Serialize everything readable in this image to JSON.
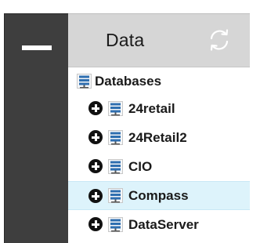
{
  "panel": {
    "title": "Data",
    "refresh_icon": "refresh-icon",
    "collapse_icon": "minus-icon"
  },
  "tree": {
    "root": {
      "label": "Databases",
      "icon": "database-icon"
    },
    "items": [
      {
        "label": "24retail",
        "icon": "database-icon",
        "expander": "plus-circle-icon",
        "selected": false
      },
      {
        "label": "24Retail2",
        "icon": "database-icon",
        "expander": "plus-circle-icon",
        "selected": false
      },
      {
        "label": "CIO",
        "icon": "database-icon",
        "expander": "plus-circle-icon",
        "selected": false
      },
      {
        "label": "Compass",
        "icon": "database-icon",
        "expander": "plus-circle-icon",
        "selected": true
      },
      {
        "label": "DataServer",
        "icon": "database-icon",
        "expander": "plus-circle-icon",
        "selected": false
      }
    ]
  },
  "colors": {
    "rail": "#3e3e3e",
    "header": "#d6d6d6",
    "selected_row": "#ddf3fb",
    "db_icon_blue": "#2f6fb0"
  }
}
